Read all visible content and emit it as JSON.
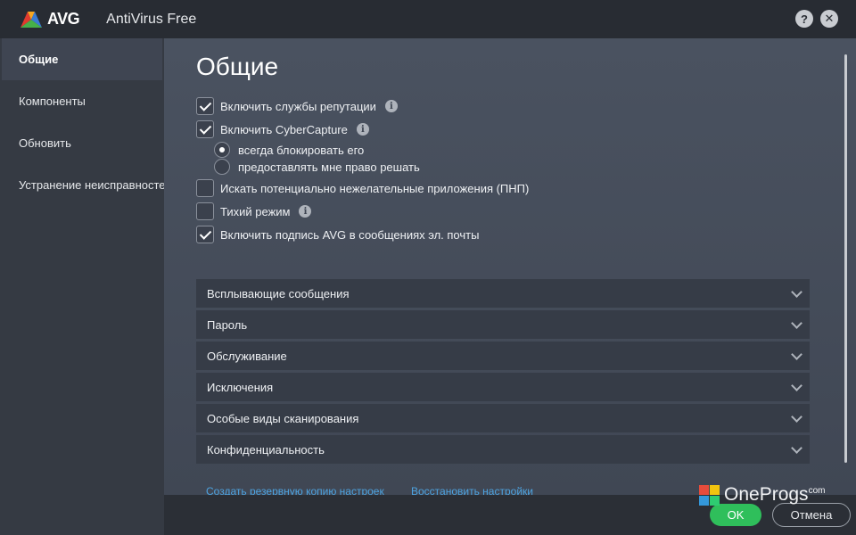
{
  "titlebar": {
    "brand": "AVG",
    "app_title": "AntiVirus Free",
    "help_label": "?",
    "close_label": "✕"
  },
  "sidebar": {
    "items": [
      {
        "label": "Общие",
        "active": true
      },
      {
        "label": "Компоненты",
        "active": false
      },
      {
        "label": "Обновить",
        "active": false
      },
      {
        "label": "Устранение неисправностей",
        "active": false
      }
    ]
  },
  "main": {
    "title": "Общие",
    "options": [
      {
        "label": "Включить службы репутации",
        "checked": true,
        "info": true
      },
      {
        "label": "Включить CyberCapture",
        "checked": true,
        "info": true
      },
      {
        "label": "Искать потенциально нежелательные приложения (ПНП)",
        "checked": false,
        "info": false
      },
      {
        "label": "Тихий режим",
        "checked": false,
        "info": true
      },
      {
        "label": "Включить подпись AVG в сообщениях эл. почты",
        "checked": true,
        "info": false
      }
    ],
    "cybercapture_radios": [
      {
        "label": "всегда блокировать его",
        "checked": true
      },
      {
        "label": "предоставлять мне право решать",
        "checked": false
      }
    ],
    "info_glyph": "i",
    "sections": [
      "Всплывающие сообщения",
      "Пароль",
      "Обслуживание",
      "Исключения",
      "Особые виды сканирования",
      "Конфиденциальность"
    ],
    "links": {
      "backup": "Создать резервную копию настроек",
      "restore": "Восстановить настройки"
    }
  },
  "footer": {
    "ok_label": "OK",
    "cancel_label": "Отмена"
  },
  "watermark": {
    "text": "OneProgs",
    "suffix": "com"
  },
  "colors": {
    "accent_green": "#2fbf5b",
    "link_blue": "#4da3e0",
    "titlebar_bg": "#282c33",
    "sidebar_bg": "#353a43"
  }
}
